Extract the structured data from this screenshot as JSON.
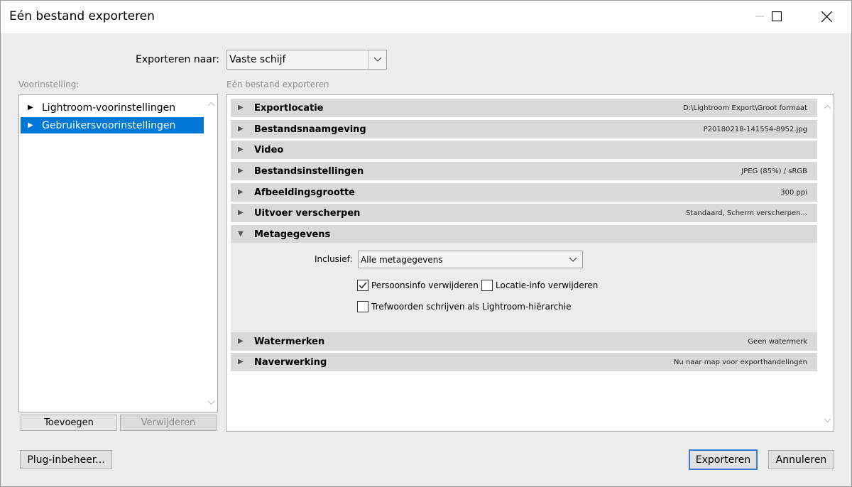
{
  "window": {
    "title": "Eén bestand exporteren"
  },
  "export_to": {
    "label": "Exporteren naar:",
    "value": "Vaste schijf"
  },
  "presets": {
    "label": "Voorinstelling:",
    "items": [
      {
        "label": "Lightroom-voorinstellingen",
        "selected": false
      },
      {
        "label": "Gebruikersvoorinstellingen",
        "selected": true
      }
    ],
    "add_label": "Toevoegen",
    "remove_label": "Verwijderen"
  },
  "panel": {
    "label": "Eén bestand exporteren",
    "sections": [
      {
        "name": "Exportlocatie",
        "summary": "D:\\Lightroom Export\\Groot formaat"
      },
      {
        "name": "Bestandsnaamgeving",
        "summary": "P20180218-141554-8952.jpg"
      },
      {
        "name": "Video",
        "summary": ""
      },
      {
        "name": "Bestandsinstellingen",
        "summary": "JPEG (85%) / sRGB"
      },
      {
        "name": "Afbeeldingsgrootte",
        "summary": "300 ppi"
      },
      {
        "name": "Uitvoer verscherpen",
        "summary": "Standaard, Scherm verscherpen..."
      },
      {
        "name": "Metagegevens",
        "summary": ""
      },
      {
        "name": "Watermerken",
        "summary": "Geen watermerk"
      },
      {
        "name": "Naverwerking",
        "summary": "Nu naar map voor exporthandelingen"
      }
    ],
    "metadata": {
      "include_label": "Inclusief:",
      "include_value": "Alle metagegevens",
      "remove_person_label": "Persoonsinfo verwijderen",
      "remove_person_checked": true,
      "remove_location_label": "Locatie-info verwijderen",
      "remove_location_checked": false,
      "keywords_hierarchy_label": "Trefwoorden schrijven als Lightroom-hiërarchie",
      "keywords_hierarchy_checked": false
    }
  },
  "footer": {
    "plugin_label": "Plug-inbeheer...",
    "export_label": "Exporteren",
    "cancel_label": "Annuleren"
  },
  "icons": {
    "collapsed": "triangle-right-icon",
    "expanded": "triangle-down-icon"
  },
  "colors": {
    "selection": "#0078d7",
    "section_header": "#d9d9d9",
    "dialog_bg": "#ececec"
  }
}
